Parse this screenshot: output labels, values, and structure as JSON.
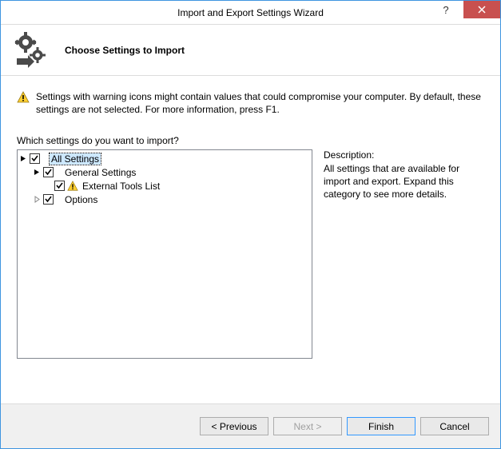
{
  "window": {
    "title": "Import and Export Settings Wizard"
  },
  "header": {
    "subtitle": "Choose Settings to Import"
  },
  "warning": {
    "text": "Settings with warning icons might contain values that could compromise your computer. By default, these settings are not selected. For more information, press F1."
  },
  "question": "Which settings do you want to import?",
  "tree": {
    "root": {
      "label": "All Settings",
      "checked": true,
      "selected": true,
      "expanded": true,
      "children": [
        {
          "label": "General Settings",
          "checked": true,
          "expanded": true,
          "children": [
            {
              "label": "External Tools List",
              "checked": true,
              "warning": true
            }
          ]
        },
        {
          "label": "Options",
          "checked": true,
          "expanded": false
        }
      ]
    }
  },
  "description": {
    "label": "Description:",
    "text": "All settings that are available for import and export. Expand this category to see more details."
  },
  "buttons": {
    "previous": "< Previous",
    "next": "Next >",
    "finish": "Finish",
    "cancel": "Cancel"
  }
}
